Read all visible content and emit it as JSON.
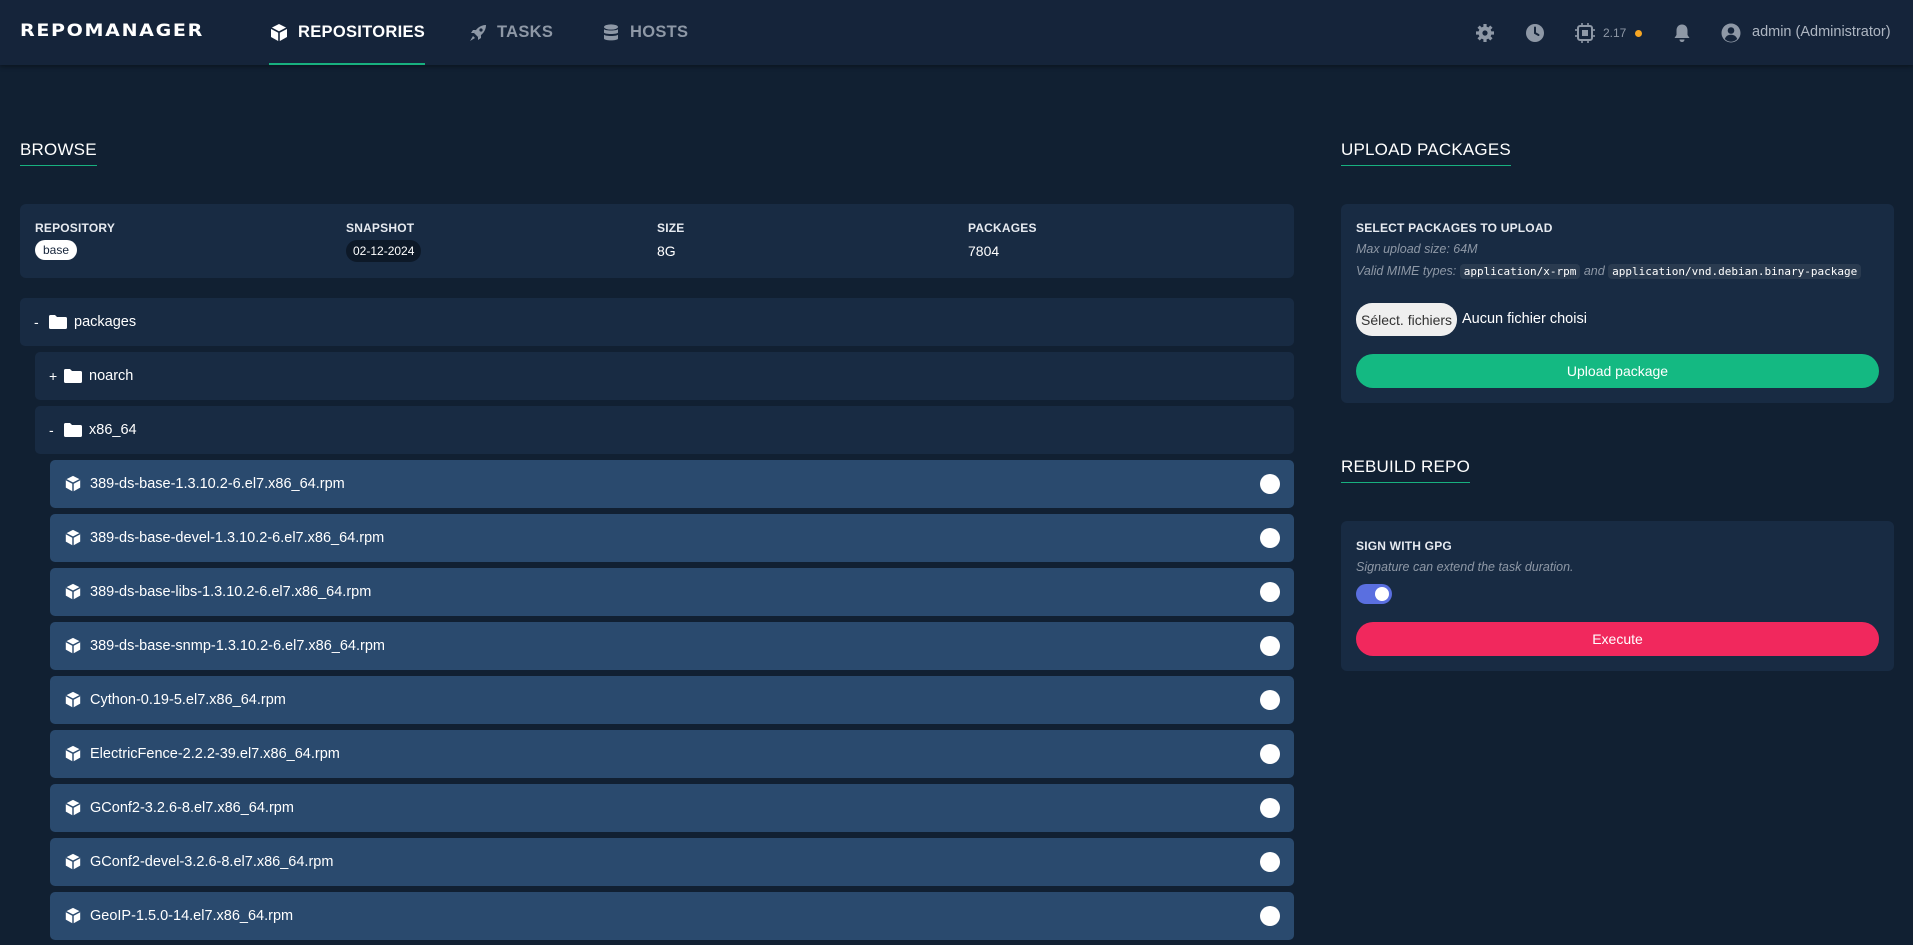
{
  "app": {
    "logo": "REPOMANAGER",
    "version": "2.17",
    "version_dot_color": "#f6a623",
    "accent_color": "#18b07f"
  },
  "nav": {
    "items": [
      {
        "label": "REPOSITORIES",
        "icon": "cube-icon",
        "active": true
      },
      {
        "label": "TASKS",
        "icon": "rocket-icon",
        "active": false
      },
      {
        "label": "HOSTS",
        "icon": "database-icon",
        "active": false
      }
    ]
  },
  "header": {
    "icons": [
      "gear-icon",
      "clock-icon",
      "cpu-icon",
      "bell-icon",
      "user-circle-icon"
    ],
    "user": "admin (Administrator)"
  },
  "browse": {
    "title": "BROWSE",
    "repository_label": "REPOSITORY",
    "repository": "base",
    "snapshot_label": "SNAPSHOT",
    "snapshot": "02-12-2024",
    "size_label": "SIZE",
    "size": "8G",
    "packages_label": "PACKAGES",
    "packages_count": "7804"
  },
  "tree": {
    "root": {
      "toggle": "-",
      "name": "packages"
    },
    "folders": [
      {
        "toggle": "+",
        "name": "noarch"
      },
      {
        "toggle": "-",
        "name": "x86_64"
      }
    ],
    "packages": [
      "389-ds-base-1.3.10.2-6.el7.x86_64.rpm",
      "389-ds-base-devel-1.3.10.2-6.el7.x86_64.rpm",
      "389-ds-base-libs-1.3.10.2-6.el7.x86_64.rpm",
      "389-ds-base-snmp-1.3.10.2-6.el7.x86_64.rpm",
      "Cython-0.19-5.el7.x86_64.rpm",
      "ElectricFence-2.2.2-39.el7.x86_64.rpm",
      "GConf2-3.2.6-8.el7.x86_64.rpm",
      "GConf2-devel-3.2.6-8.el7.x86_64.rpm",
      "GeoIP-1.5.0-14.el7.x86_64.rpm"
    ]
  },
  "upload": {
    "title": "UPLOAD PACKAGES",
    "card_title": "SELECT PACKAGES TO UPLOAD",
    "max_size": "Max upload size: 64M",
    "mime_prefix": "Valid MIME types:",
    "mime_rpm": "application/x-rpm",
    "mime_and": "and",
    "mime_deb": "application/vnd.debian.binary-package",
    "file_button": "Sélect. fichiers",
    "file_status": "Aucun fichier choisi",
    "submit": "Upload package",
    "submit_color": "#14b982"
  },
  "rebuild": {
    "title": "REBUILD REPO",
    "card_title": "SIGN WITH GPG",
    "note": "Signature can extend the task duration.",
    "gpg_enabled": true,
    "execute": "Execute",
    "execute_color": "#f1285d"
  }
}
